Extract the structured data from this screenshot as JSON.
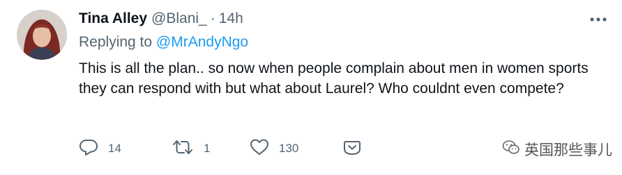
{
  "tweet": {
    "author_name": "Tina Alley",
    "author_handle": "@Blani_",
    "separator": "·",
    "timestamp": "14h",
    "replying_prefix": "Replying to",
    "replying_to": "@MrAndyNgo",
    "text": "This is all the plan.. so now when people complain about men in women sports they can respond with but what about Laurel? Who couldnt even compete?",
    "icons": {
      "more": "more-horizontal-icon",
      "reply": "reply-icon",
      "retweet": "retweet-icon",
      "like": "heart-icon",
      "share": "share-icon"
    }
  },
  "actions": {
    "replies": "14",
    "retweets": "1",
    "likes": "130"
  },
  "watermark": {
    "text": "英国那些事儿"
  },
  "colors": {
    "text": "#0f1419",
    "secondary": "#536471",
    "link": "#1d9bf0"
  }
}
